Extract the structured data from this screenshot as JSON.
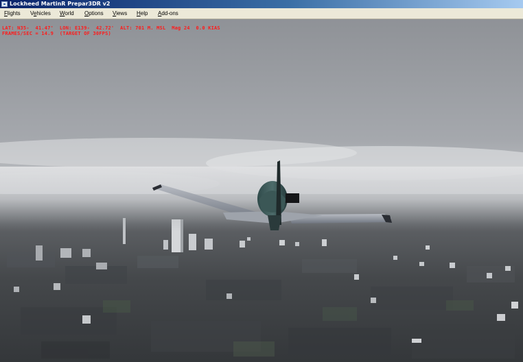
{
  "window": {
    "title": "Lockheed MartinR Prepar3DR v2"
  },
  "menu": [
    {
      "label": "Flights",
      "mnemonic": "F",
      "rest": "lights"
    },
    {
      "label": "Vehicles",
      "mnemonic": "e",
      "before": "V",
      "rest": "hicles"
    },
    {
      "label": "World",
      "mnemonic": "W",
      "rest": "orld"
    },
    {
      "label": "Options",
      "mnemonic": "O",
      "rest": "ptions"
    },
    {
      "label": "Views",
      "mnemonic": "V",
      "rest": "iews"
    },
    {
      "label": "Help",
      "mnemonic": "H",
      "rest": "elp"
    },
    {
      "label": "Add-ons",
      "mnemonic": "A",
      "rest": "dd-ons"
    }
  ],
  "hud": {
    "position_line": "LAT: N35-  41.47'  LON: E139-  42.72'  ALT: 701 M. MSL  Mag 24  0.0 KIAS",
    "fps_line": "FRAMES/SEC = 14.9  (TARGET OF 30FPS)",
    "color": "#ff1a1a"
  },
  "scene": {
    "description_icon": "aircraft-rear-view",
    "sky_color": "#a5a8ad",
    "ground_color": "#3a3d40"
  }
}
